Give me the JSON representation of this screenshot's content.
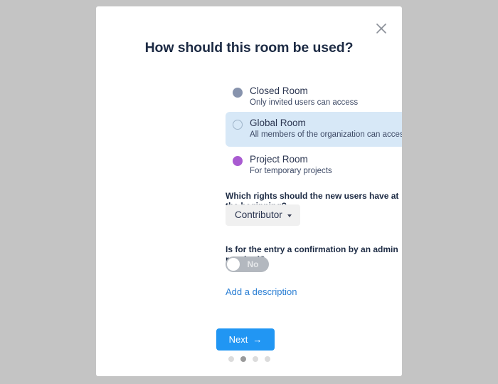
{
  "backdrop": {
    "color": "#c4c4c4"
  },
  "modal": {
    "title": "How should this room be used?",
    "close_icon": "close-icon",
    "accent_color": "#2196f3",
    "selected_row_bg": "#d7e8f7"
  },
  "options": [
    {
      "id": "closed-room",
      "label": "Closed Room",
      "description": "Only invited users can access",
      "icon": "filled-circle-icon",
      "icon_color": "#8793ad",
      "selected": false
    },
    {
      "id": "global-room",
      "label": "Global Room",
      "description": "All members of the organization can access",
      "icon": "outline-circle-icon",
      "icon_color": "#9fb4c9",
      "selected": true,
      "check_icon": "check-icon",
      "check_color": "#4a8fc4"
    },
    {
      "id": "project-room",
      "label": "Project Room",
      "description": "For temporary projects",
      "icon": "filled-circle-icon",
      "icon_color": "#a95bd1",
      "selected": false
    }
  ],
  "rights": {
    "question": "Which rights should the new users have at the beginning?",
    "selected_value": "Contributor",
    "caret_icon": "chevron-down-icon"
  },
  "confirmation": {
    "question": "Is for the entry a confirmation by an admin required?",
    "toggle_value": "No",
    "toggle_on": false
  },
  "description_link": {
    "label": "Add a description"
  },
  "footer": {
    "next_label": "Next",
    "next_arrow": "→",
    "pager": {
      "total": 4,
      "active_index": 1
    }
  }
}
